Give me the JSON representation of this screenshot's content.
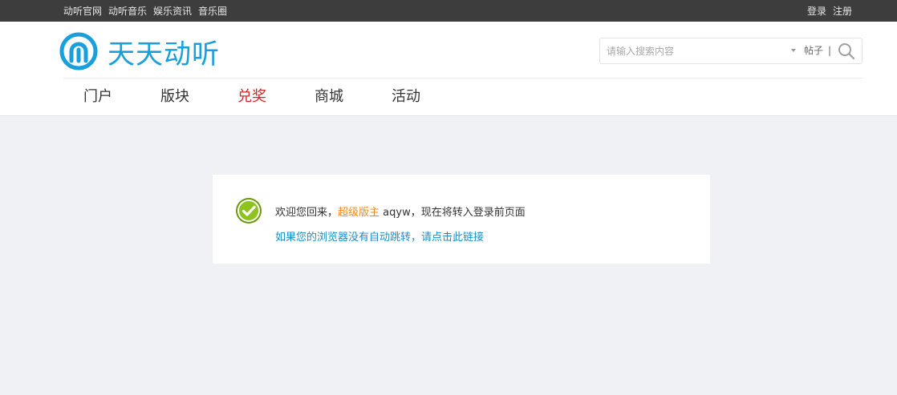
{
  "topbar": {
    "links": [
      "动听官网",
      "动听音乐",
      "娱乐资讯",
      "音乐圈"
    ],
    "login": "登录",
    "register": "注册"
  },
  "header": {
    "logo_text": "天天动听",
    "search": {
      "placeholder": "请输入搜索内容",
      "scope": "帖子",
      "separator": "|"
    },
    "nav": [
      {
        "label": "门户",
        "active": false
      },
      {
        "label": "版块",
        "active": false
      },
      {
        "label": "兑奖",
        "active": true
      },
      {
        "label": "商城",
        "active": false
      },
      {
        "label": "活动",
        "active": false
      }
    ]
  },
  "message": {
    "prefix": "欢迎您回来，",
    "role": "超级版主",
    "username": " aqyw",
    "suffix": "，现在将转入登录前页面",
    "link": "如果您的浏览器没有自动跳转，请点击此链接"
  },
  "colors": {
    "brand": "#1a9fdd",
    "active_nav": "#d62222",
    "role": "#f08a1c",
    "link": "#1a8fc9",
    "check_green": "#8dc21f"
  }
}
